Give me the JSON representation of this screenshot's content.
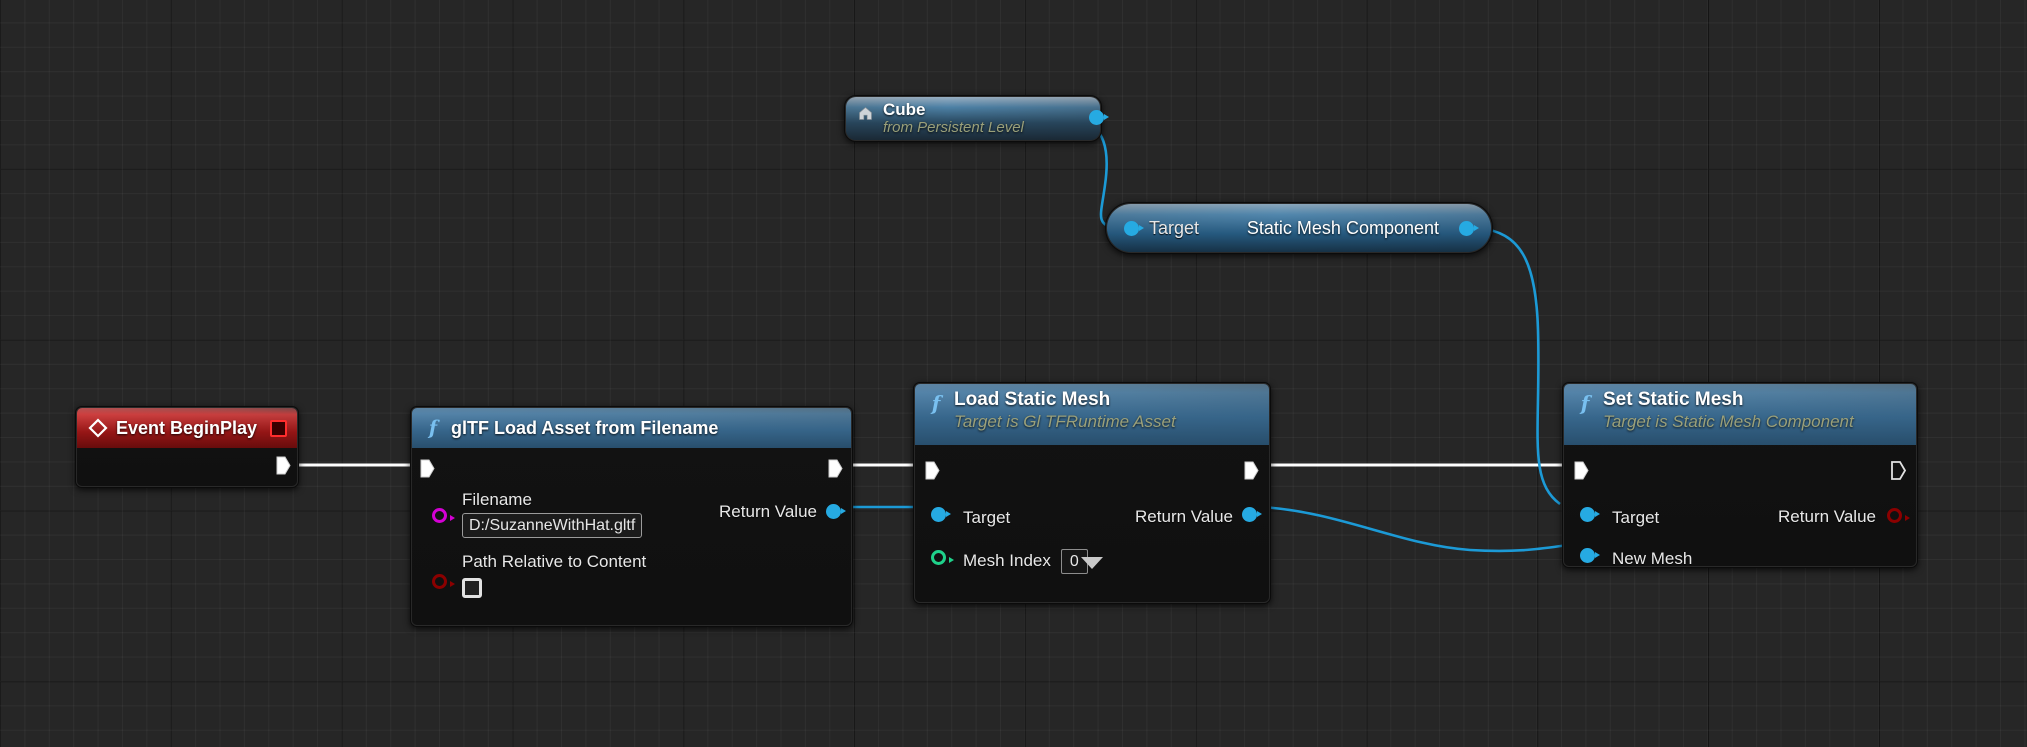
{
  "app": {
    "context": "Unreal Engine Blueprint Event Graph",
    "background_color": "#262626",
    "grid_line_color": "#2f2f2f",
    "grid_major_color": "#000000"
  },
  "pin_colors": {
    "exec_white": "#ffffff",
    "object_blue": "#26aae2",
    "string_magenta": "#d400d4",
    "boolean_dark_red": "#8b0000",
    "integer_green": "#1fd18a",
    "event_red": "#ff2d2d"
  },
  "nodes": [
    {
      "id": "event-begin-play",
      "name": "event-begin-play-node",
      "title": "Event BeginPlay",
      "subtitle": "",
      "icon": "event-diamond-icon",
      "header_style": "event",
      "delegate_pin": true,
      "outputs_exec": [
        {
          "label": "",
          "state": "filled"
        }
      ],
      "inputs": [],
      "outputs": []
    },
    {
      "id": "gltf-load-asset-from-filename",
      "name": "gltf-load-asset-from-filename-node",
      "title": "glTF Load Asset from Filename",
      "subtitle": "",
      "icon": "function-f-icon",
      "header_style": "function",
      "inputs_exec": [
        {
          "label": "",
          "state": "filled"
        }
      ],
      "outputs_exec": [
        {
          "label": "",
          "state": "filled"
        }
      ],
      "inputs": [
        {
          "label": "Filename",
          "pin_type": "string",
          "pin_state": "hollow",
          "widget": "textbox",
          "value": "D:/SuzanneWithHat.gltf"
        },
        {
          "label": "Path Relative to Content",
          "pin_type": "boolean",
          "pin_state": "hollow",
          "widget": "checkbox",
          "value": "unchecked"
        }
      ],
      "outputs": [
        {
          "label": "Return Value",
          "pin_type": "object",
          "pin_state": "filled"
        }
      ]
    },
    {
      "id": "load-static-mesh",
      "name": "load-static-mesh-node",
      "title": "Load Static Mesh",
      "subtitle": "Target is Gl TFRuntime Asset",
      "icon": "function-f-icon",
      "header_style": "function",
      "inputs_exec": [
        {
          "label": "",
          "state": "filled"
        }
      ],
      "outputs_exec": [
        {
          "label": "",
          "state": "filled"
        }
      ],
      "inputs": [
        {
          "label": "Target",
          "pin_type": "object",
          "pin_state": "filled",
          "widget": "none",
          "value": ""
        },
        {
          "label": "Mesh Index",
          "pin_type": "integer",
          "pin_state": "hollow",
          "widget": "numbox",
          "value": "0"
        }
      ],
      "outputs": [
        {
          "label": "Return Value",
          "pin_type": "object",
          "pin_state": "filled"
        }
      ],
      "expander": true
    },
    {
      "id": "set-static-mesh",
      "name": "set-static-mesh-node",
      "title": "Set Static Mesh",
      "subtitle": "Target is Static Mesh Component",
      "icon": "function-f-icon",
      "header_style": "function",
      "inputs_exec": [
        {
          "label": "",
          "state": "filled"
        }
      ],
      "outputs_exec": [
        {
          "label": "",
          "state": "hollow"
        }
      ],
      "inputs": [
        {
          "label": "Target",
          "pin_type": "object",
          "pin_state": "filled",
          "widget": "none",
          "value": ""
        },
        {
          "label": "New Mesh",
          "pin_type": "object",
          "pin_state": "filled",
          "widget": "none",
          "value": ""
        }
      ],
      "outputs": [
        {
          "label": "Return Value",
          "pin_type": "boolean",
          "pin_state": "hollow"
        }
      ]
    },
    {
      "id": "cube-actor-ref",
      "name": "cube-actor-reference-node",
      "title": "Cube",
      "subtitle": "from Persistent Level",
      "icon": "actor-house-icon",
      "header_style": "actor",
      "outputs": [
        {
          "label": "",
          "pin_type": "object",
          "pin_state": "filled"
        }
      ]
    },
    {
      "id": "static-mesh-component-ref",
      "name": "static-mesh-component-variable-node",
      "title": "Static Mesh Component",
      "subtitle": "",
      "icon": "",
      "header_style": "pill",
      "inputs": [
        {
          "label": "Target",
          "pin_type": "object",
          "pin_state": "filled"
        }
      ],
      "outputs": [
        {
          "label": "",
          "pin_type": "object",
          "pin_state": "filled"
        }
      ]
    }
  ],
  "connections": [
    {
      "from": "event-begin-play.exec_out",
      "to": "gltf-load-asset-from-filename.exec_in",
      "type": "exec",
      "color": "#ffffff"
    },
    {
      "from": "gltf-load-asset-from-filename.exec_out",
      "to": "load-static-mesh.exec_in",
      "type": "exec",
      "color": "#ffffff"
    },
    {
      "from": "load-static-mesh.exec_out",
      "to": "set-static-mesh.exec_in",
      "type": "exec",
      "color": "#ffffff"
    },
    {
      "from": "gltf-load-asset-from-filename.Return Value",
      "to": "load-static-mesh.Target",
      "type": "data",
      "color": "#1c9ad6"
    },
    {
      "from": "cube-actor-ref.out",
      "to": "static-mesh-component-ref.Target",
      "type": "data",
      "color": "#1c9ad6"
    },
    {
      "from": "static-mesh-component-ref.out",
      "to": "set-static-mesh.Target",
      "type": "data",
      "color": "#1c9ad6"
    },
    {
      "from": "load-static-mesh.Return Value",
      "to": "set-static-mesh.New Mesh",
      "type": "data",
      "color": "#1c9ad6"
    }
  ]
}
